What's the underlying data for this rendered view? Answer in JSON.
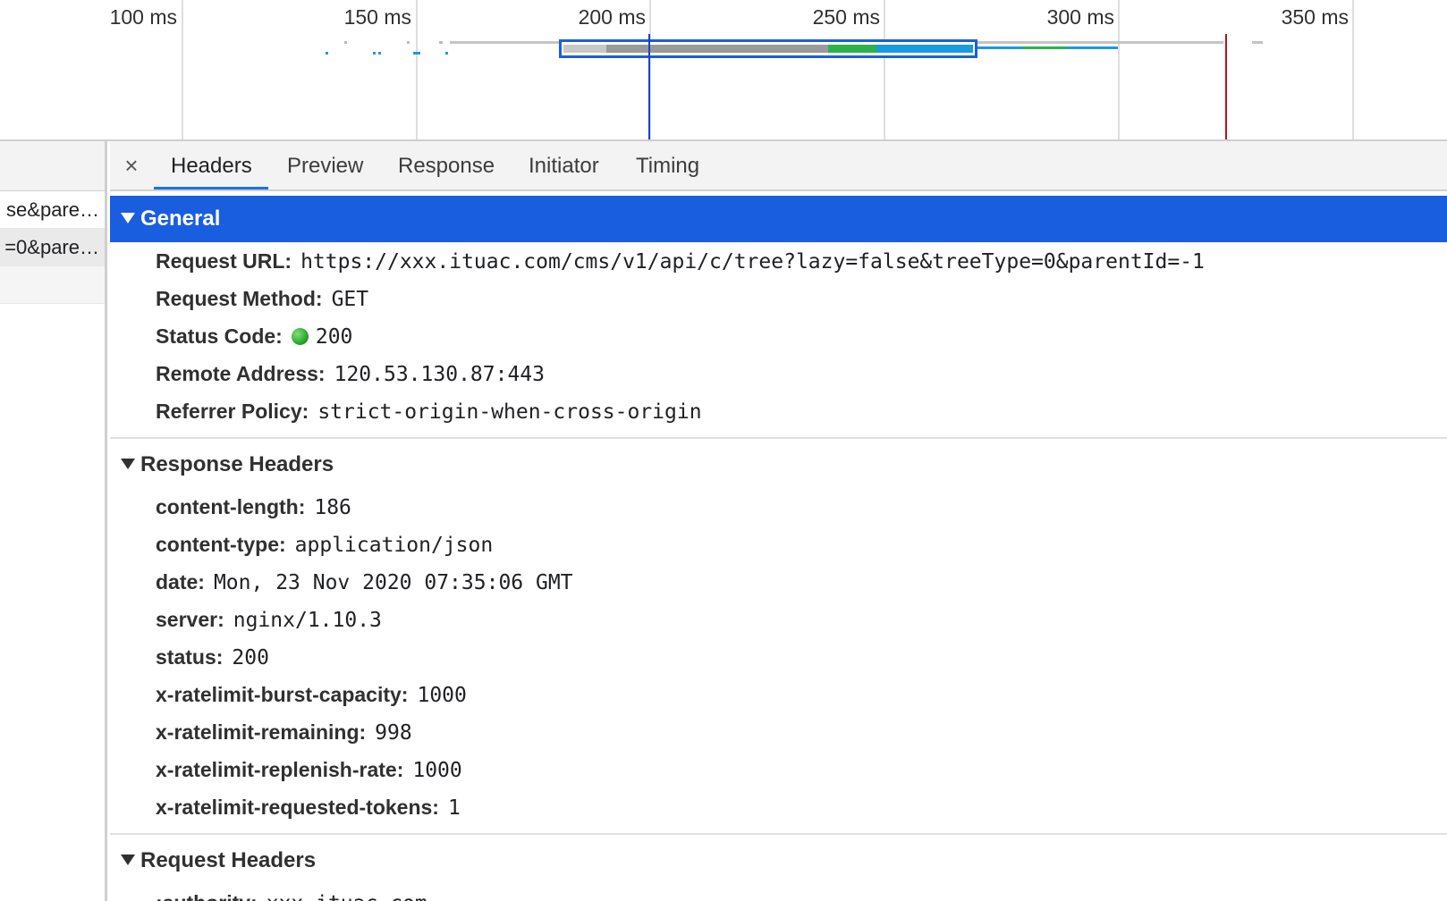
{
  "timeline": {
    "ticks": [
      "100 ms",
      "150 ms",
      "200 ms",
      "250 ms",
      "300 ms",
      "350 ms"
    ]
  },
  "request_list": {
    "rows": [
      "se&pare…",
      "=0&pare…"
    ]
  },
  "tabs": {
    "close_label": "×",
    "items": [
      "Headers",
      "Preview",
      "Response",
      "Initiator",
      "Timing"
    ],
    "active": "Headers"
  },
  "general": {
    "title": "General",
    "request_url_key": "Request URL:",
    "request_url": "https://xxx.ituac.com/cms/v1/api/c/tree?lazy=false&treeType=0&parentId=-1",
    "request_method_key": "Request Method:",
    "request_method": "GET",
    "status_code_key": "Status Code:",
    "status_code": "200",
    "remote_address_key": "Remote Address:",
    "remote_address": "120.53.130.87:443",
    "referrer_policy_key": "Referrer Policy:",
    "referrer_policy": "strict-origin-when-cross-origin"
  },
  "response_headers": {
    "title": "Response Headers",
    "items": [
      {
        "key": "content-length:",
        "value": "186"
      },
      {
        "key": "content-type:",
        "value": "application/json"
      },
      {
        "key": "date:",
        "value": "Mon, 23 Nov 2020 07:35:06 GMT"
      },
      {
        "key": "server:",
        "value": "nginx/1.10.3"
      },
      {
        "key": "status:",
        "value": "200"
      },
      {
        "key": "x-ratelimit-burst-capacity:",
        "value": "1000"
      },
      {
        "key": "x-ratelimit-remaining:",
        "value": "998"
      },
      {
        "key": "x-ratelimit-replenish-rate:",
        "value": "1000"
      },
      {
        "key": "x-ratelimit-requested-tokens:",
        "value": "1"
      }
    ]
  },
  "request_headers": {
    "title": "Request Headers",
    "first_key": ":authority:",
    "first_value": "xxx.ituac.com"
  },
  "colors": {
    "accent": "#1a5ee0",
    "status_ok": "#1e9e1e",
    "load_marker": "#c0101a",
    "dom_marker": "#1a3fcf"
  }
}
